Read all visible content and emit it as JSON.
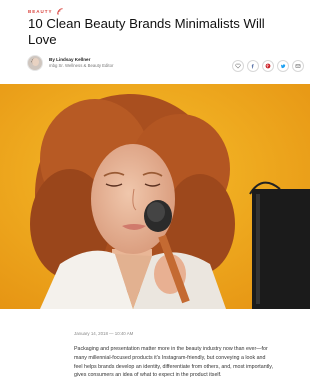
{
  "category": {
    "label": "BEAUTY",
    "icon": "signal-icon",
    "color": "#d9453f"
  },
  "article": {
    "title": "10 Clean Beauty Brands Minimalists Will Love",
    "author": "By Lindsay Kellner",
    "author_role": "mbg Sr. Wellness & Beauty Editor",
    "date": "January 14, 2018 — 10:40 AM",
    "body": "Packaging and presentation matter more in the beauty industry now than ever—for many millennial-focused products it's Instagram-friendly, but conveying a look and feel helps brands develop an identity, differentiate from others, and, most importantly, gives consumers an idea of what to expect in the product itself."
  },
  "share": [
    {
      "icon": "heart-icon"
    },
    {
      "icon": "facebook-icon",
      "color": "#3b5998"
    },
    {
      "icon": "pinterest-icon",
      "color": "#cb2027"
    },
    {
      "icon": "twitter-icon",
      "color": "#1da1f2"
    },
    {
      "icon": "email-icon"
    }
  ],
  "hero": {
    "background": "#f2b21e",
    "subject": "woman with curly red hair applying makeup brush"
  }
}
